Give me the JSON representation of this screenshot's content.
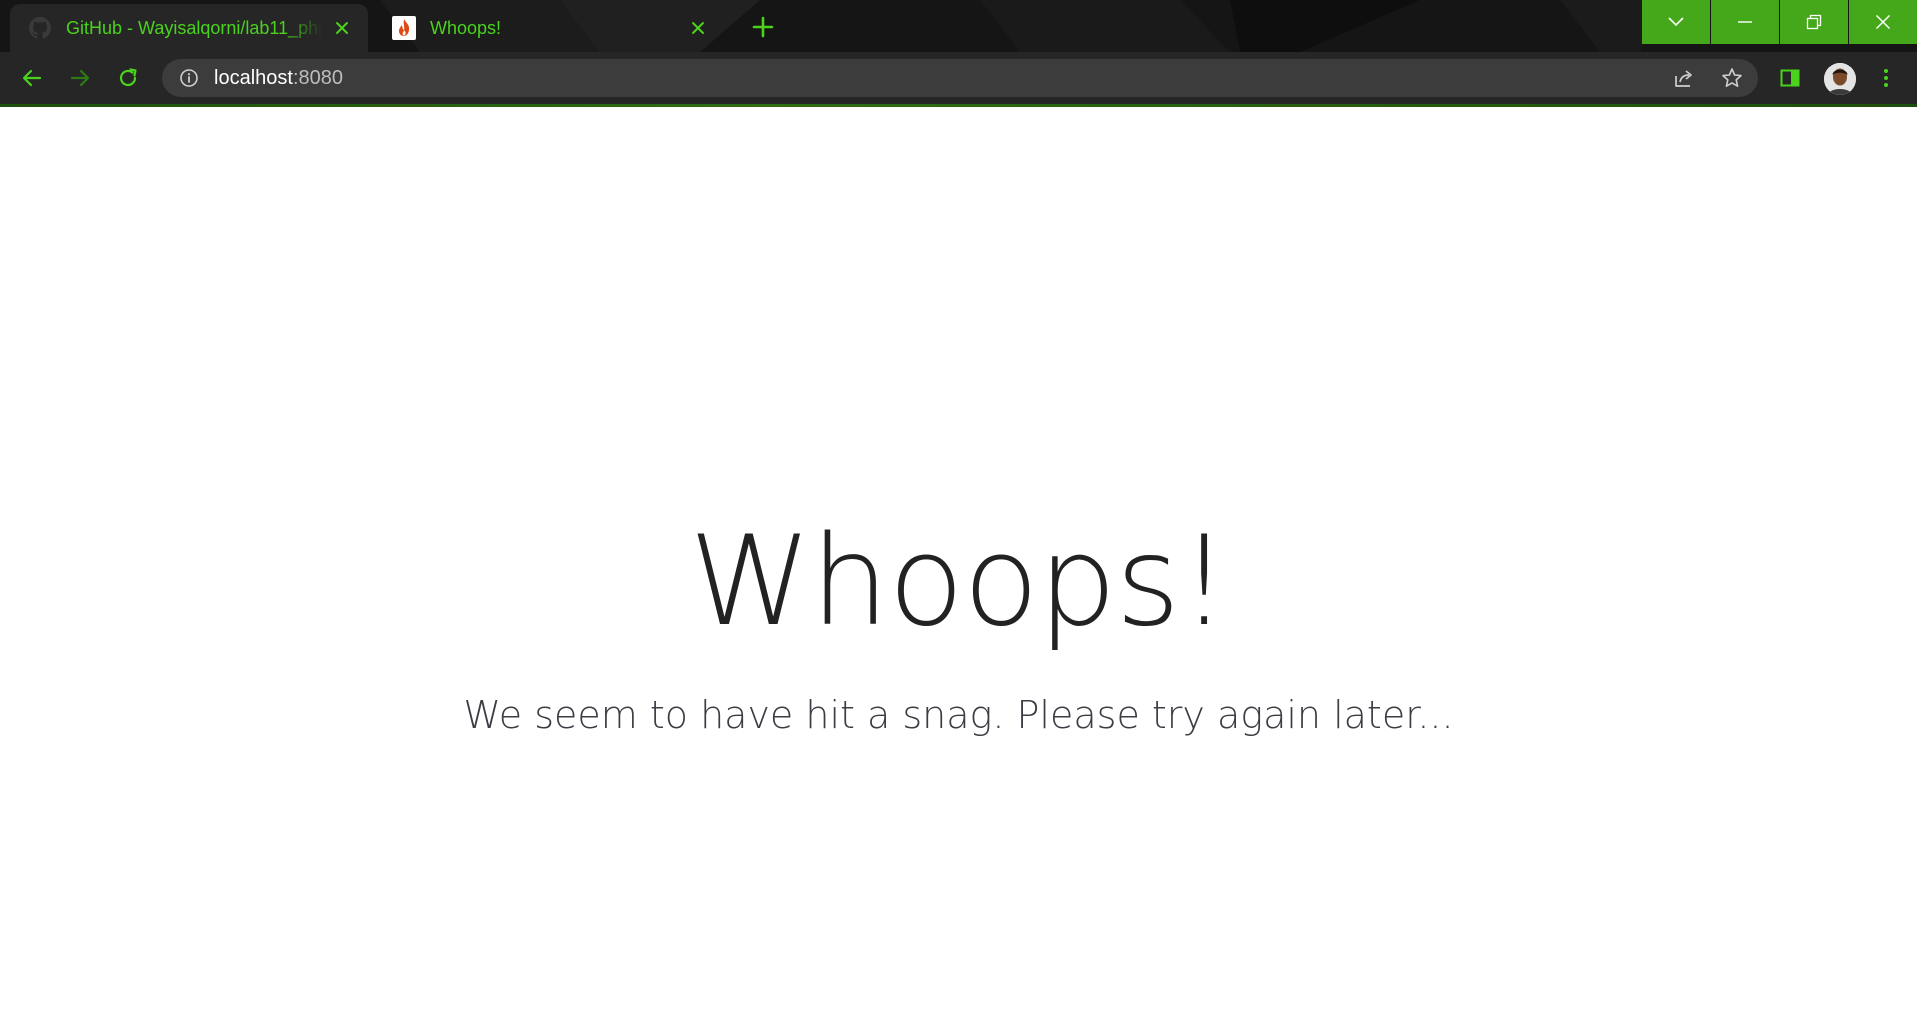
{
  "browser": {
    "tabs": [
      {
        "title": "GitHub - Wayisalqorni/lab11_php",
        "icon": "github-icon",
        "active": true
      },
      {
        "title": "Whoops!",
        "icon": "codeigniter-flame-icon",
        "active": false
      }
    ],
    "address_bar": {
      "host": "localhost",
      "port": ":8080"
    },
    "colors": {
      "accent": "#4ad21c",
      "window_controls": "#45a81a",
      "toolbar": "#262626",
      "frame": "#141414"
    }
  },
  "page": {
    "headline": "Whoops!",
    "message": "We seem to have hit a snag. Please try again later..."
  }
}
